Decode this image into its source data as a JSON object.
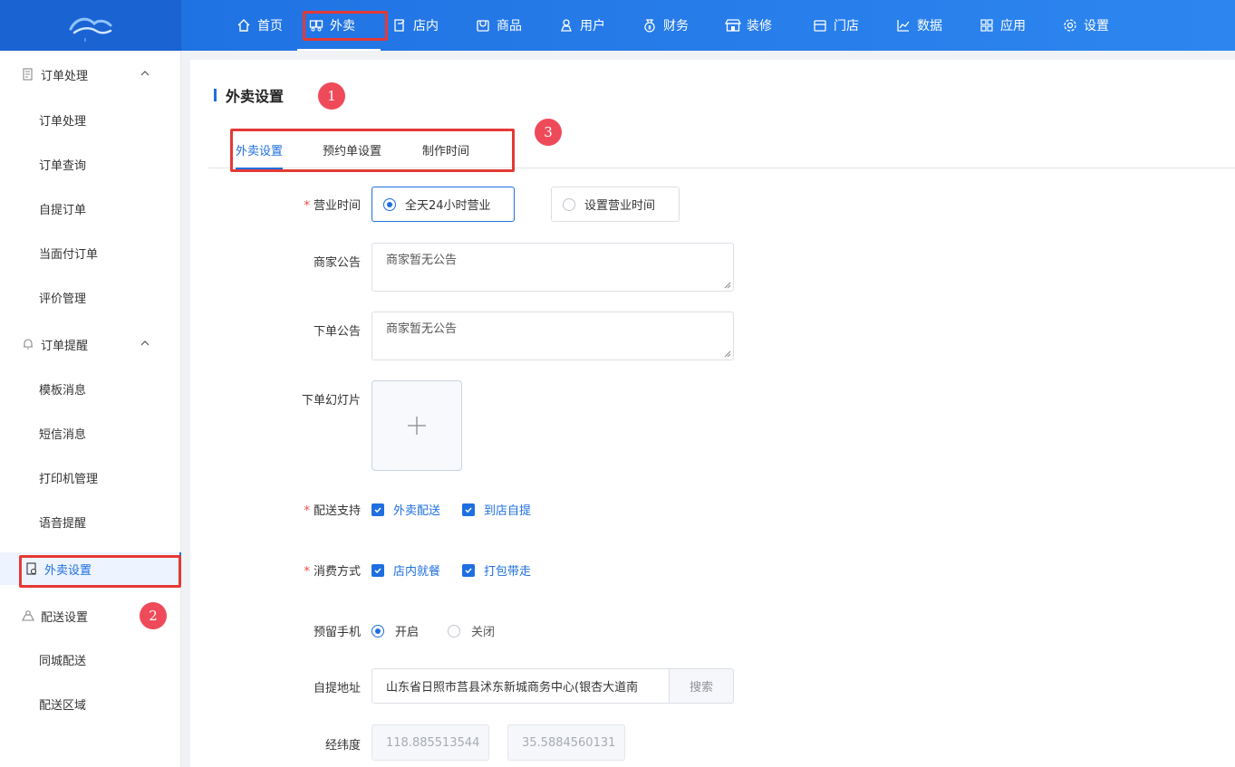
{
  "nav": {
    "items": [
      {
        "label": "首页",
        "icon": "home-icon"
      },
      {
        "label": "外卖",
        "icon": "takeout-icon"
      },
      {
        "label": "店内",
        "icon": "store-inside-icon"
      },
      {
        "label": "商品",
        "icon": "goods-icon"
      },
      {
        "label": "用户",
        "icon": "user-icon"
      },
      {
        "label": "财务",
        "icon": "finance-icon"
      },
      {
        "label": "装修",
        "icon": "decorate-icon"
      },
      {
        "label": "门店",
        "icon": "shop-icon"
      },
      {
        "label": "数据",
        "icon": "chart-icon"
      },
      {
        "label": "应用",
        "icon": "apps-icon"
      },
      {
        "label": "设置",
        "icon": "gear-icon"
      }
    ],
    "active": "外卖"
  },
  "sidebar": {
    "groups": [
      {
        "label": "订单处理",
        "items": [
          "订单处理",
          "订单查询",
          "自提订单",
          "当面付订单",
          "评价管理"
        ]
      },
      {
        "label": "订单提醒",
        "items": [
          "模板消息",
          "短信消息",
          "打印机管理",
          "语音提醒"
        ]
      },
      {
        "active_item": "外卖设置"
      },
      {
        "label": "配送设置",
        "items": [
          "同城配送",
          "配送区域"
        ]
      }
    ]
  },
  "badges": [
    "1",
    "2",
    "3"
  ],
  "page": {
    "title": "外卖设置",
    "tabs": [
      "外卖设置",
      "预约单设置",
      "制作时间"
    ],
    "active_tab": "外卖设置"
  },
  "form": {
    "business_hours": {
      "label": "营业时间",
      "options": [
        "全天24小时营业",
        "设置营业时间"
      ],
      "selected": "全天24小时营业"
    },
    "merchant_notice": {
      "label": "商家公告",
      "value": "商家暂无公告"
    },
    "order_notice": {
      "label": "下单公告",
      "value": "商家暂无公告"
    },
    "order_slides": {
      "label": "下单幻灯片"
    },
    "delivery_support": {
      "label": "配送支持",
      "options": [
        "外卖配送",
        "到店自提"
      ]
    },
    "consume_method": {
      "label": "消费方式",
      "options": [
        "店内就餐",
        "打包带走"
      ]
    },
    "reserve_phone": {
      "label": "预留手机",
      "options": [
        "开启",
        "关闭"
      ],
      "selected": "开启"
    },
    "pickup_address": {
      "label": "自提地址",
      "value": "山东省日照市莒县沭东新城商务中心(银杏大道南",
      "button": "搜索"
    },
    "coordinates": {
      "label": "经纬度",
      "lng": "118.885513544",
      "lat": "35.5884560131"
    }
  },
  "colors": {
    "primary": "#1e6fe0",
    "highlight": "#e53935",
    "badge": "#ef4a5a",
    "required": "#f04545"
  }
}
